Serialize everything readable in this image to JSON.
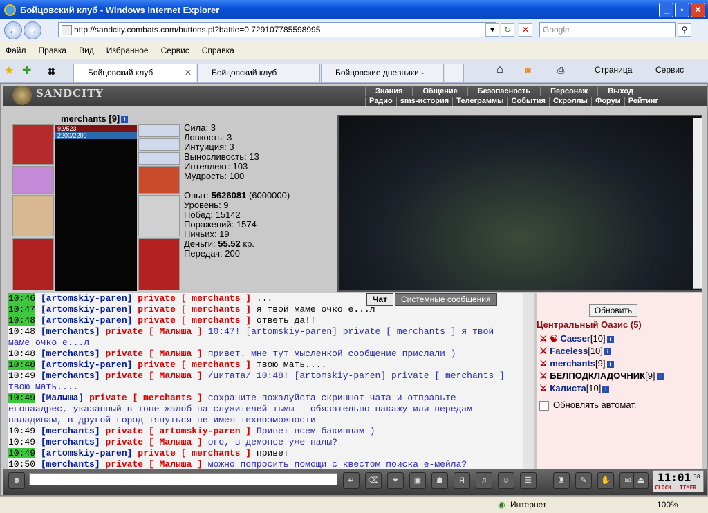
{
  "window": {
    "title": "Бойцовский клуб - Windows Internet Explorer"
  },
  "address": {
    "url": "http://sandcity.combats.com/buttons.pl?battle=0.729107785598995",
    "search_placeholder": "Google"
  },
  "menu": [
    "Файл",
    "Правка",
    "Вид",
    "Избранное",
    "Сервис",
    "Справка"
  ],
  "tabs": [
    {
      "label": "Бойцовский клуб"
    },
    {
      "label": "Бойцовский клуб"
    },
    {
      "label": "Бойцовские дневники - scr..."
    }
  ],
  "toolbar": {
    "page": "Страница",
    "tools": "Сервис"
  },
  "game": {
    "logo": "SANDCITY",
    "nav1": [
      "Знания",
      "Общение",
      "Безопасность",
      "Персонаж",
      "Выход"
    ],
    "nav2": [
      "Радио",
      "sms-история",
      "Телеграммы",
      "События",
      "Скроллы",
      "Форум",
      "Рейтинг"
    ],
    "char": {
      "name": "merchants",
      "level": "[9]",
      "hp": "92/523",
      "mp": "2200/2200"
    },
    "stats": [
      "Сила: 3",
      "Ловкость: 3",
      "Интуиция: 3",
      "Выносливость: 13",
      "Интеллект: 103",
      "Мудрость: 100"
    ],
    "stats2": [
      {
        "label": "Опыт: ",
        "value": "5626081",
        "extra": " (6000000)"
      },
      {
        "label": "Уровень: 9"
      },
      {
        "label": "Побед: 15142"
      },
      {
        "label": "Поражений: 1574"
      },
      {
        "label": "Ничьих: 19"
      },
      {
        "label": "Деньги: ",
        "value": "55.52",
        "extra": " кр."
      },
      {
        "label": "Передач: 200"
      }
    ],
    "chat_tabs": [
      "Чат",
      "Системные сообщения"
    ],
    "chat": [
      {
        "t": "10:46",
        "hl": true,
        "u": "[artomskiy-paren]",
        "p": "private [ merchants ]",
        "m": "...",
        "blk": true
      },
      {
        "t": "10:47",
        "hl": true,
        "u": "[artomskiy-paren]",
        "p": "private [ merchants ]",
        "m": "я твой маме очко е...л",
        "blk": true
      },
      {
        "t": "10:48",
        "hl": true,
        "u": "[artomskiy-paren]",
        "p": "private [ merchants ]",
        "m": "ответь да!!",
        "blk": true
      },
      {
        "t": "10:48",
        "hl": false,
        "u": "[merchants]",
        "p": "private [ Малыша ]",
        "m": "10:47! [artomskiy-paren] private [ merchants ] я твой маме очко е...л"
      },
      {
        "t": "10:48",
        "hl": false,
        "u": "[merchants]",
        "p": "private [ Малыша ]",
        "m": "привет. мне тут мысленкой сообщение прислали )"
      },
      {
        "t": "10:48",
        "hl": true,
        "u": "[artomskiy-paren]",
        "p": "private [ merchants ]",
        "m": "твою мать....",
        "blk": true
      },
      {
        "t": "10:49",
        "hl": false,
        "u": "[merchants]",
        "p": "private [ Малыша ]",
        "m": "/цитата/ 10:48! [artomskiy-paren] private [ merchants ] твою мать...."
      },
      {
        "t": "10:49",
        "hl": true,
        "u": "[Малыша]",
        "p": "private [ merchants ]",
        "m": "сохраните пожалуйста скриншот чата и отправьте егонаадрес, указанный в топе жалоб на служителей тьмы - обязательно накажу или передам паладинам, в другой город тянуться не имею техвозможности"
      },
      {
        "t": "10:49",
        "hl": false,
        "u": "[merchants]",
        "p": "private [ artomskiy-paren ]",
        "m": "Привет всем бакинцам )"
      },
      {
        "t": "10:49",
        "hl": false,
        "u": "[merchants]",
        "p": "private [ Малыша ]",
        "m": "ого, в демонсе уже палы?"
      },
      {
        "t": "10:49",
        "hl": true,
        "u": "[artomskiy-paren]",
        "p": "private [ merchants ]",
        "m": "привет",
        "blk": true
      },
      {
        "t": "10:50",
        "hl": false,
        "u": "[merchants]",
        "p": "private [ Малыша ]",
        "m": "можно попросить помощи с квестом поиска е-мейла?"
      }
    ],
    "online": {
      "refresh": "Обновить",
      "room": "Центральный Оазис (5)",
      "users": [
        {
          "name": "Caeser",
          "lvl": "[10]"
        },
        {
          "name": "Faceless",
          "lvl": "[10]"
        },
        {
          "name": "merchants",
          "lvl": "[9]"
        },
        {
          "name": "БЕЛПОДКЛАДОЧНИК",
          "lvl": "[9]"
        },
        {
          "name": "Калиста",
          "lvl": "[10]"
        }
      ],
      "auto": "Обновлять автомат."
    },
    "clock": {
      "time": "11:01",
      "sec": "30",
      "a": "CLOCK",
      "b": "TIMER"
    }
  },
  "status": {
    "zone": "Интернет",
    "zoom": "100%"
  }
}
